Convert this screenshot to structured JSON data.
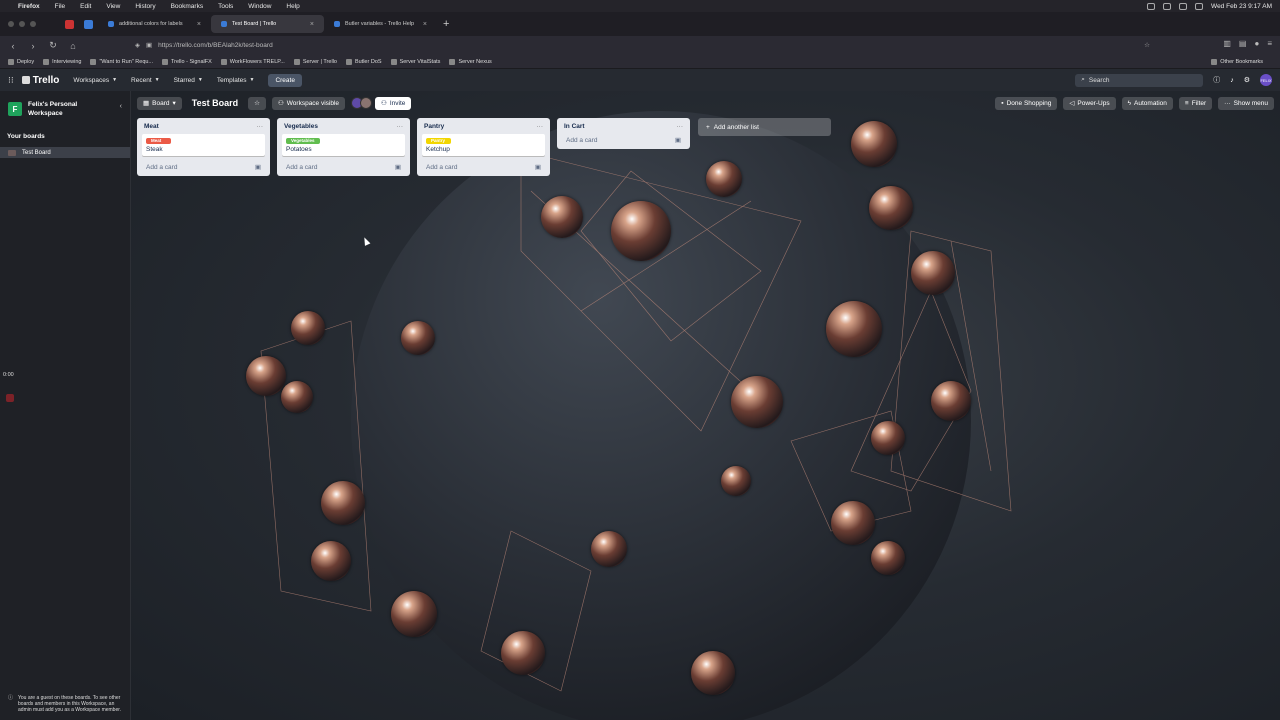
{
  "menubar": {
    "app": "Firefox",
    "items": [
      "File",
      "Edit",
      "View",
      "History",
      "Bookmarks",
      "Tools",
      "Window",
      "Help"
    ],
    "clock": "Wed Feb 23  9:17 AM"
  },
  "tabs": [
    {
      "label": "additional colors for labels",
      "active": false
    },
    {
      "label": "Test Board | Trello",
      "active": true
    },
    {
      "label": "Butler variables - Trello Help",
      "active": false
    }
  ],
  "url": "https://trello.com/b/BEAlah2k/test-board",
  "bookmarks": {
    "items": [
      "Deploy",
      "Interviewing",
      "\"Want to Run\" Requ...",
      "Trello - SignalFX",
      "WorkFlowers TRELP...",
      "Server | Trello",
      "Butler DoS",
      "Server VitalStats",
      "Server Nexus"
    ],
    "other": "Other Bookmarks"
  },
  "header": {
    "logo": "Trello",
    "menus": [
      "Workspaces",
      "Recent",
      "Starred",
      "Templates"
    ],
    "create": "Create",
    "search_placeholder": "Search",
    "avatar": "FELIX"
  },
  "sidebar": {
    "workspace": "Felix's Personal Workspace",
    "workspace_initial": "F",
    "your_boards": "Your boards",
    "boards": [
      "Test Board"
    ],
    "timer": "0:00",
    "guest_note": "You are a guest on these boards. To see other boards and members in this Workspace, an admin must add you as a Workspace member."
  },
  "board": {
    "view": "Board",
    "title": "Test Board",
    "visibility": "Workspace visible",
    "invite": "Invite",
    "buttons": [
      "Done Shopping",
      "Power-Ups",
      "Automation",
      "Filter",
      "Show menu"
    ],
    "add_list": "Add another list",
    "add_card": "Add a card"
  },
  "lists": [
    {
      "name": "Meat",
      "cards": [
        {
          "label": "Meat",
          "label_color": "#eb5a46",
          "title": "Steak"
        }
      ]
    },
    {
      "name": "Vegetables",
      "cards": [
        {
          "label": "Vegetables",
          "label_color": "#61bd4f",
          "title": "Potatoes"
        }
      ]
    },
    {
      "name": "Pantry",
      "cards": [
        {
          "label": "Pantry",
          "label_color": "#f2d600",
          "title": "Ketchup"
        }
      ]
    },
    {
      "name": "In Cart",
      "cards": []
    }
  ]
}
